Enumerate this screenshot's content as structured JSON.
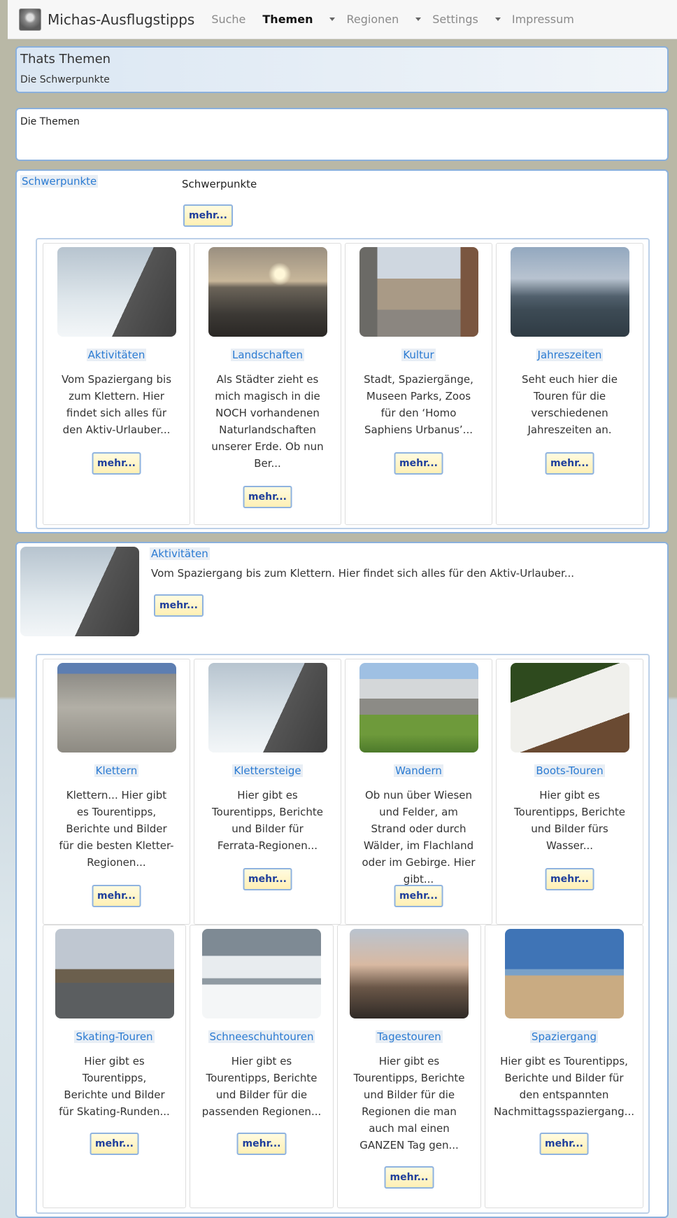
{
  "navbar": {
    "brand": "Michas-Ausflugstipps",
    "items": [
      {
        "label": "Suche"
      },
      {
        "label": "Themen"
      },
      {
        "label": "Regionen"
      },
      {
        "label": "Settings"
      },
      {
        "label": "Impressum"
      }
    ]
  },
  "header": {
    "title": "Thats Themen",
    "subtitle": "Die Schwerpunkte"
  },
  "themen": {
    "title": "Die Themen"
  },
  "schwerpunkte": {
    "link": "Schwerpunkte",
    "text": "Schwerpunkte",
    "more": "mehr...",
    "cards": [
      {
        "title": "Aktivitäten",
        "desc": "Vom Spaziergang bis zum Klettern. Hier findet sich alles für den Aktiv-Urlauber...",
        "more": "mehr..."
      },
      {
        "title": "Landschaften",
        "desc": "Als Städter zieht es mich magisch in die NOCH vorhandenen Naturlandschaften unserer Erde. Ob nun Ber...",
        "more": "mehr..."
      },
      {
        "title": "Kultur",
        "desc": "Stadt, Spaziergänge, Museen Parks, Zoos für den ‘Homo Saphiens Urbanus’...",
        "more": "mehr..."
      },
      {
        "title": "Jahreszeiten",
        "desc": "Seht euch hier die Touren für die verschiedenen Jahreszeiten an.",
        "more": "mehr..."
      }
    ]
  },
  "aktivitaeten": {
    "title": "Aktivitäten",
    "desc": "Vom Spaziergang bis zum Klettern. Hier findet sich alles für den Aktiv-Urlauber...",
    "more": "mehr...",
    "cards": [
      {
        "title": "Klettern",
        "desc": "Klettern... Hier gibt es Tourentipps, Berichte und Bilder für die besten Kletter-Regionen...",
        "more": "mehr..."
      },
      {
        "title": "Klettersteige",
        "desc": "Hier gibt es Tourentipps, Berichte und Bilder für Ferrata-Regionen...",
        "more": "mehr..."
      },
      {
        "title": "Wandern",
        "desc": "Ob nun über Wiesen und Felder, am Strand oder durch Wälder, im Flachland oder im Gebirge. Hier gibt...",
        "more": "mehr..."
      },
      {
        "title": "Boots-Touren",
        "desc": "Hier gibt es Tourentipps, Berichte und Bilder fürs Wasser...",
        "more": "mehr..."
      },
      {
        "title": "Skating-Touren",
        "desc": "Hier gibt es Tourentipps, Berichte und Bilder für Skating-Runden...",
        "more": "mehr..."
      },
      {
        "title": "Schneeschuhtouren",
        "desc": "Hier gibt es Tourentipps, Berichte und Bilder für die passenden Regionen...",
        "more": "mehr..."
      },
      {
        "title": "Tagestouren",
        "desc": "Hier gibt es Tourentipps, Berichte und Bilder für die Regionen die man auch mal einen GANZEN Tag gen...",
        "more": "mehr..."
      },
      {
        "title": "Spaziergang",
        "desc": "Hier gibt es Tourentipps, Berichte und Bilder für den entspannten Nachmittagsspaziergang...",
        "more": "mehr..."
      }
    ]
  }
}
